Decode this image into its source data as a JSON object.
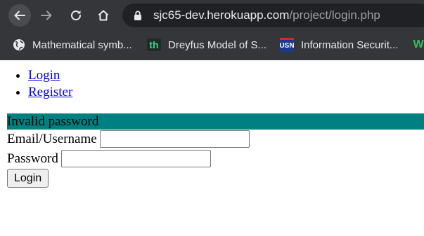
{
  "browser": {
    "url_host": "sjc65-dev.herokuapp.com",
    "url_path": "/project/login.php",
    "bookmarks": [
      {
        "label": "Mathematical symb...",
        "icon": "globe-icon"
      },
      {
        "label": "Dreyfus Model of S...",
        "icon": "th-favicon"
      },
      {
        "label": "Information Securit...",
        "icon": "usn-favicon"
      },
      {
        "label": "",
        "icon": "w-favicon"
      }
    ],
    "favicons": {
      "th": "th",
      "usn": "USN",
      "w": "W"
    }
  },
  "nav": {
    "items": [
      {
        "label": "Login"
      },
      {
        "label": "Register"
      }
    ]
  },
  "form": {
    "error_message": "Invalid password",
    "email_label": "Email/Username",
    "email_value": "",
    "password_label": "Password",
    "password_value": "",
    "submit_label": "Login"
  },
  "colors": {
    "error_bar": "#008080",
    "chrome_bg": "#35363a",
    "link": "#0000ee"
  }
}
